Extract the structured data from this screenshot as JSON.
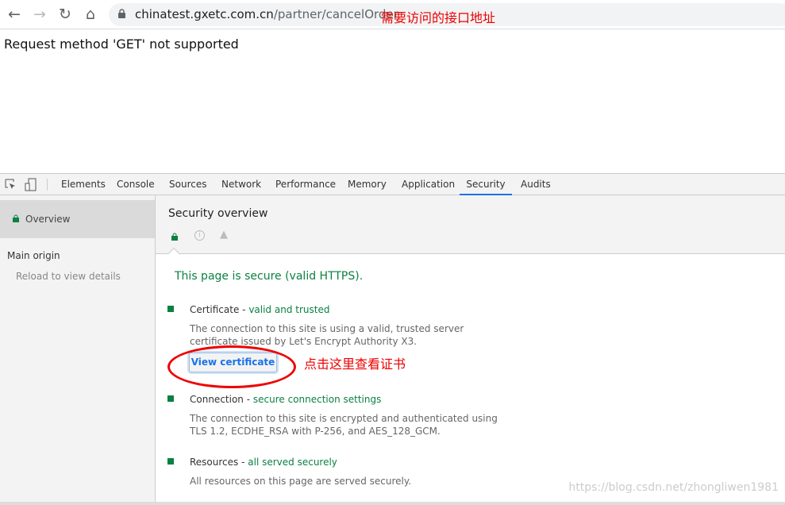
{
  "browser": {
    "url_host": "chinatest.gxetc.com.cn",
    "url_path": "/partner/cancelOrder",
    "annotation": "需要访问的接口地址"
  },
  "page": {
    "message": "Request method 'GET' not supported"
  },
  "devtools": {
    "tabs": [
      "Elements",
      "Console",
      "Sources",
      "Network",
      "Performance",
      "Memory",
      "Application",
      "Security",
      "Audits"
    ],
    "active_tab": "Security"
  },
  "sidebar": {
    "overview": "Overview",
    "main_origin": "Main origin",
    "reload": "Reload to view details"
  },
  "main": {
    "title": "Security overview",
    "summary": "This page is secure (valid HTTPS).",
    "certificate": {
      "label": "Certificate",
      "status": "valid and trusted",
      "desc": "The connection to this site is using a valid, trusted server certificate issued by Let's Encrypt Authority X3.",
      "button": "View certificate"
    },
    "connection": {
      "label": "Connection",
      "status": "secure connection settings",
      "desc": "The connection to this site is encrypted and authenticated using TLS 1.2, ECDHE_RSA with P-256, and AES_128_GCM."
    },
    "resources": {
      "label": "Resources",
      "status": "all served securely",
      "desc": "All resources on this page are served securely."
    }
  },
  "annotation2": "点击这里查看证书",
  "watermark": "https://blog.csdn.net/zhongliwen1981",
  "colors": {
    "secure": "#0b8043",
    "accent": "#1a73e8",
    "annotation": "#ee0000"
  }
}
